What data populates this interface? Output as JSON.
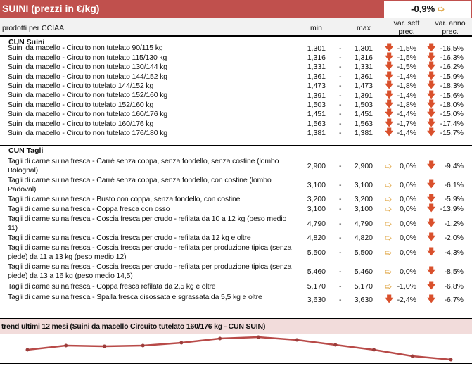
{
  "header": {
    "title": "SUINI (prezzi in €/kg)",
    "summary_value": "-0,9%",
    "summary_trend": "right"
  },
  "columns": {
    "product": "prodotti per CCIAA",
    "min": "min",
    "max": "max",
    "var_week_1": "var. sett",
    "var_week_2": "prec.",
    "var_year_1": "var. anno",
    "var_year_2": "prec."
  },
  "sections": [
    {
      "title": "CUN Suini",
      "rows": [
        {
          "desc": "Suini da macello - Circuito non tutelato 90/115 kg",
          "min": "1,301",
          "max": "1,301",
          "var_w": "-1,5%",
          "tw": "down",
          "var_y": "-16,5%",
          "ty": "down"
        },
        {
          "desc": "Suini da macello - Circuito non tutelato 115/130 kg",
          "min": "1,316",
          "max": "1,316",
          "var_w": "-1,5%",
          "tw": "down",
          "var_y": "-16,3%",
          "ty": "down"
        },
        {
          "desc": "Suini da macello - Circuito non tutelato 130/144 kg",
          "min": "1,331",
          "max": "1,331",
          "var_w": "-1,5%",
          "tw": "down",
          "var_y": "-16,2%",
          "ty": "down"
        },
        {
          "desc": "Suini da macello - Circuito non tutelato 144/152 kg",
          "min": "1,361",
          "max": "1,361",
          "var_w": "-1,4%",
          "tw": "down",
          "var_y": "-15,9%",
          "ty": "down"
        },
        {
          "desc": "Suini da macello - Circuito tutelato 144/152 kg",
          "min": "1,473",
          "max": "1,473",
          "var_w": "-1,8%",
          "tw": "down",
          "var_y": "-18,3%",
          "ty": "down"
        },
        {
          "desc": "Suini da macello - Circuito non tutelato 152/160 kg",
          "min": "1,391",
          "max": "1,391",
          "var_w": "-1,4%",
          "tw": "down",
          "var_y": "-15,6%",
          "ty": "down"
        },
        {
          "desc": "Suini da macello - Circuito tutelato 152/160 kg",
          "min": "1,503",
          "max": "1,503",
          "var_w": "-1,8%",
          "tw": "down",
          "var_y": "-18,0%",
          "ty": "down"
        },
        {
          "desc": "Suini da macello - Circuito non tutelato 160/176 kg",
          "min": "1,451",
          "max": "1,451",
          "var_w": "-1,4%",
          "tw": "down",
          "var_y": "-15,0%",
          "ty": "down"
        },
        {
          "desc": "Suini da macello - Circuito tutelato 160/176 kg",
          "min": "1,563",
          "max": "1,563",
          "var_w": "-1,7%",
          "tw": "down",
          "var_y": "-17,4%",
          "ty": "down"
        },
        {
          "desc": "Suini da macello - Circuito non tutelato 176/180 kg",
          "min": "1,381",
          "max": "1,381",
          "var_w": "-1,4%",
          "tw": "down",
          "var_y": "-15,7%",
          "ty": "down"
        }
      ]
    },
    {
      "title": "CUN Tagli",
      "rows": [
        {
          "desc": "Tagli di carne suina fresca - Carrè senza coppa, senza fondello, senza costine (lombo Bolognal)",
          "min": "2,900",
          "max": "2,900",
          "var_w": "0,0%",
          "tw": "right",
          "var_y": "-9,4%",
          "ty": "down"
        },
        {
          "desc": "Tagli di carne suina fresca - Carrè senza coppa, senza fondello, con costine (lombo Padoval)",
          "min": "3,100",
          "max": "3,100",
          "var_w": "0,0%",
          "tw": "right",
          "var_y": "-6,1%",
          "ty": "down"
        },
        {
          "desc": "Tagli di carne suina fresca - Busto con coppa, senza fondello, con costine",
          "min": "3,200",
          "max": "3,200",
          "var_w": "0,0%",
          "tw": "right",
          "var_y": "-5,9%",
          "ty": "down"
        },
        {
          "desc": "Tagli di carne suina fresca - Coppa fresca con osso",
          "min": "3,100",
          "max": "3,100",
          "var_w": "0,0%",
          "tw": "right",
          "var_y": "-13,9%",
          "ty": "down"
        },
        {
          "desc": "Tagli di carne suina fresca - Coscia fresca per crudo - refilata da 10 a 12 kg (peso medio 11)",
          "min": "4,790",
          "max": "4,790",
          "var_w": "0,0%",
          "tw": "right",
          "var_y": "-1,2%",
          "ty": "down"
        },
        {
          "desc": "Tagli di carne suina fresca - Coscia fresca per crudo - refilata da 12 kg e oltre",
          "min": "4,820",
          "max": "4,820",
          "var_w": "0,0%",
          "tw": "right",
          "var_y": "-2,0%",
          "ty": "down"
        },
        {
          "desc": "Tagli di carne suina fresca - Coscia fresca per crudo - refilata per produzione tipica (senza piede) da 11 a 13 kg (peso medio 12)",
          "min": "5,500",
          "max": "5,500",
          "var_w": "0,0%",
          "tw": "right",
          "var_y": "-4,3%",
          "ty": "down"
        },
        {
          "desc": "Tagli di carne suina fresca - Coscia fresca per crudo - refilata per produzione tipica (senza piede) da 13 a 16 kg (peso medio 14,5)",
          "min": "5,460",
          "max": "5,460",
          "var_w": "0,0%",
          "tw": "right",
          "var_y": "-8,5%",
          "ty": "down"
        },
        {
          "desc": "Tagli di carne suina fresca - Coppa fresca refilata da 2,5 kg e oltre",
          "min": "5,170",
          "max": "5,170",
          "var_w": "-1,0%",
          "tw": "right",
          "var_y": "-6,8%",
          "ty": "down"
        },
        {
          "desc": "Tagli di carne suina fresca - Spalla fresca disossata e sgrassata da 5,5 kg e oltre",
          "min": "3,630",
          "max": "3,630",
          "var_w": "-2,4%",
          "tw": "down",
          "var_y": "-6,7%",
          "ty": "down"
        }
      ]
    }
  ],
  "trend": {
    "title": "trend ultimi 12 mesi (Suini da macello Circuito tutelato 160/176 kg - CUN SUIN)"
  },
  "chart_data": {
    "type": "line",
    "title": "trend ultimi 12 mesi (Suini da macello Circuito tutelato 160/176 kg - CUN SUIN)",
    "series": [
      {
        "name": "Suini da macello Circuito tutelato 160/176 kg",
        "values": [
          1.6,
          1.66,
          1.65,
          1.66,
          1.7,
          1.76,
          1.78,
          1.74,
          1.67,
          1.6,
          1.51,
          1.46
        ]
      }
    ],
    "color": "#b84a48",
    "grid": false
  }
}
